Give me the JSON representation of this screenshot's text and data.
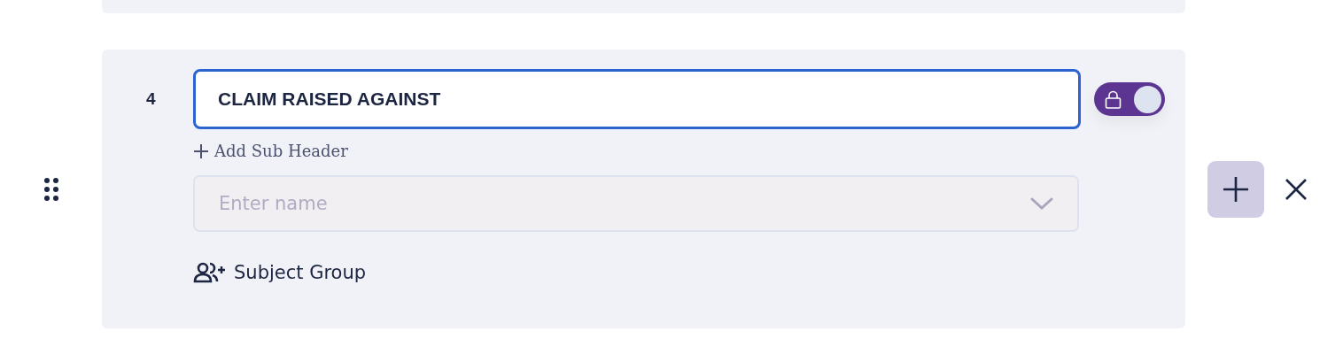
{
  "header_row": {
    "number": "4",
    "title": "CLAIM RAISED AGAINST",
    "focused": true,
    "lock_toggle": {
      "on": true
    },
    "add_sub_header": "Add Sub Header",
    "name_select": {
      "placeholder": "Enter name"
    },
    "subject_group": "Subject Group"
  }
}
